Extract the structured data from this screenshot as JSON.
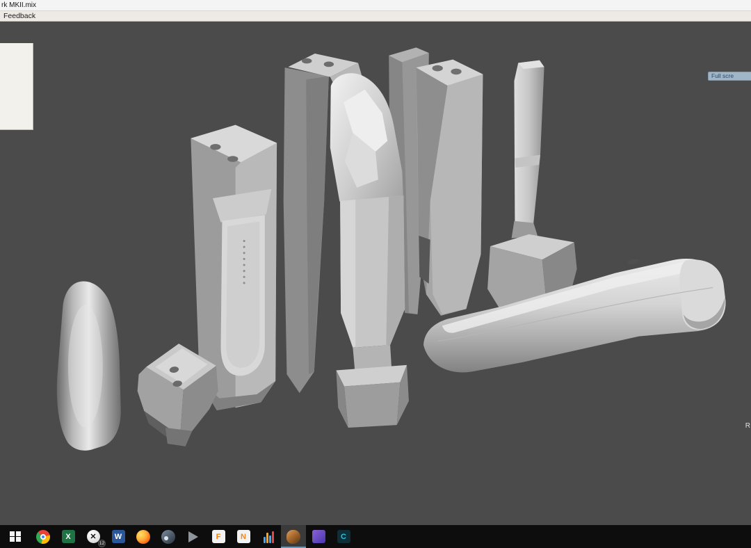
{
  "window": {
    "title": "rk MKII.mix",
    "menu": {
      "feedback": "Feedback"
    }
  },
  "viewport": {
    "background_color": "#4b4b4b",
    "fullscreen_button_label": "Full scre",
    "right_edge_label": "R",
    "model_parts": [
      "grip-shell",
      "flat-bracket-plate",
      "tall-column-left",
      "main-body-assembly",
      "back-slab",
      "receiver-column",
      "piston-rod-assembly",
      "stock-cylinder"
    ]
  },
  "taskbar": {
    "background_color": "#0d0d0d",
    "accent_color": "#6d96b5",
    "start": {
      "name": "start-button"
    },
    "apps": [
      {
        "name": "chrome-icon"
      },
      {
        "name": "excel-icon",
        "glyph": "X",
        "color": "#1e7244"
      },
      {
        "name": "xbox-icon",
        "badge": "12"
      },
      {
        "name": "word-icon",
        "glyph": "W",
        "color": "#2b579a"
      },
      {
        "name": "firefox-icon"
      },
      {
        "name": "steam-icon"
      },
      {
        "name": "play-icon"
      },
      {
        "name": "f-app-icon",
        "glyph": "F"
      },
      {
        "name": "n-app-icon",
        "glyph": "N"
      },
      {
        "name": "equalizer-icon"
      },
      {
        "name": "meshmixer-icon",
        "active": true
      },
      {
        "name": "purple-app-icon"
      },
      {
        "name": "cura-icon",
        "glyph": "C"
      }
    ]
  }
}
